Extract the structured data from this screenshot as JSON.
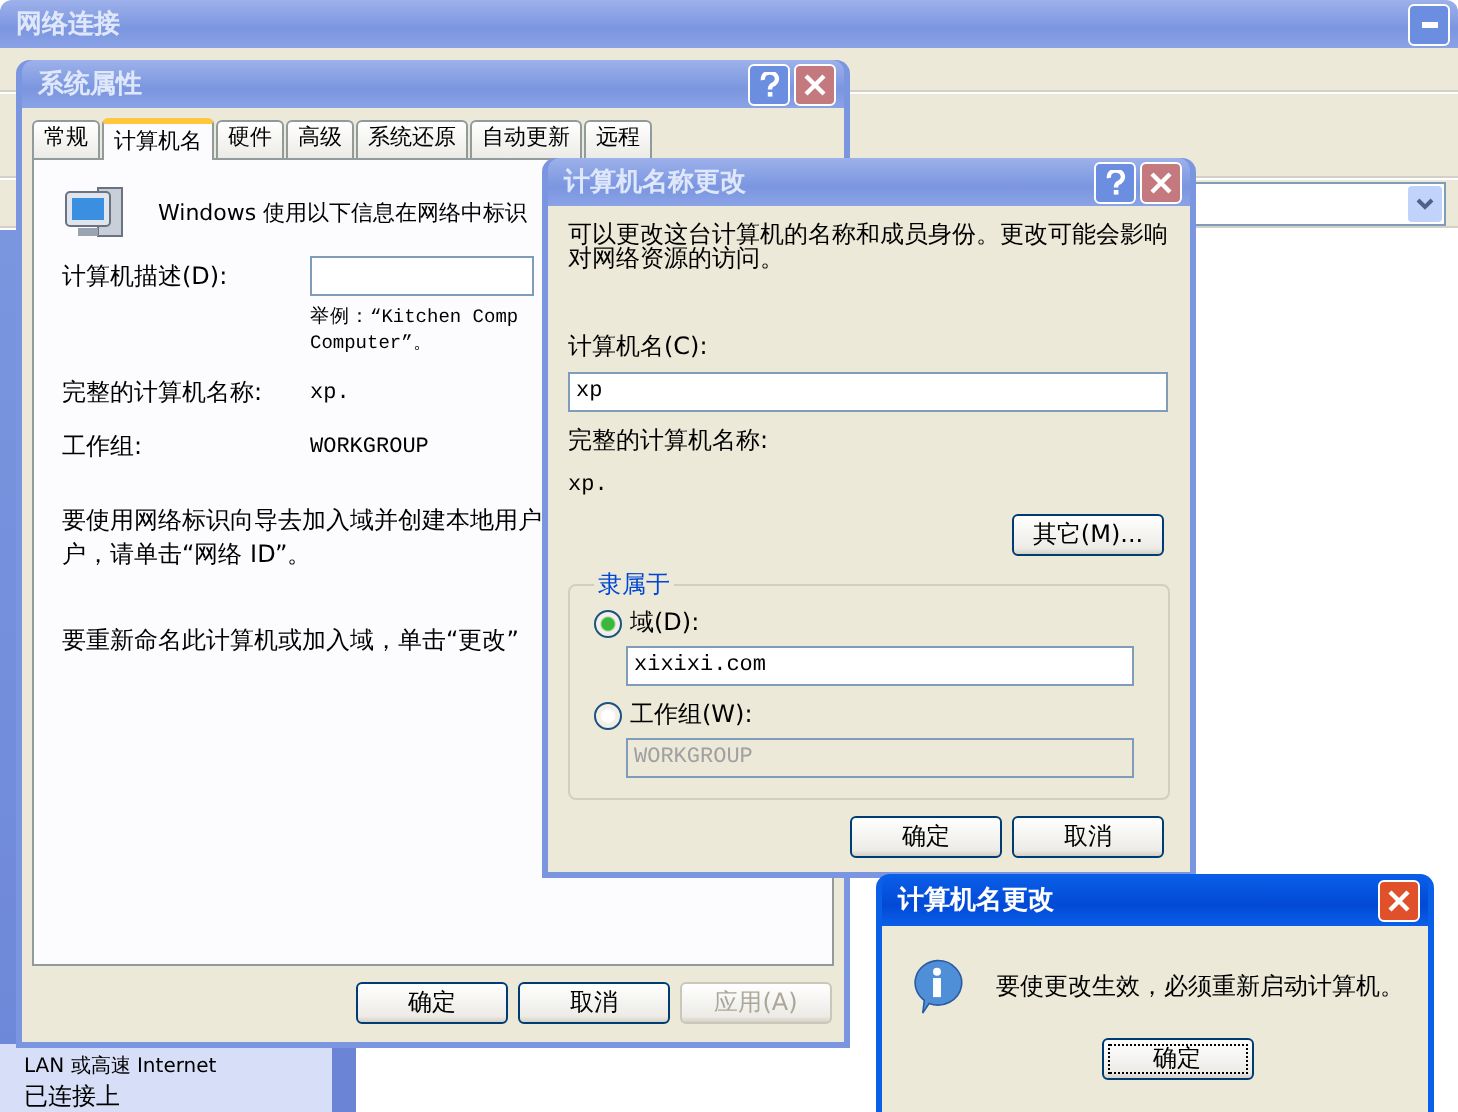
{
  "background_window": {
    "title": "网络连接",
    "details": [
      "LAN 或高速 Internet",
      "已连接上"
    ]
  },
  "system_properties": {
    "title": "系统属性",
    "tabs": [
      {
        "label": "常规",
        "selected": false
      },
      {
        "label": "计算机名",
        "selected": true
      },
      {
        "label": "硬件",
        "selected": false
      },
      {
        "label": "高级",
        "selected": false
      },
      {
        "label": "系统还原",
        "selected": false
      },
      {
        "label": "自动更新",
        "selected": false
      },
      {
        "label": "远程",
        "selected": false
      }
    ],
    "intro": "Windows 使用以下信息在网络中标识",
    "description_label": "计算机描述(D):",
    "example": [
      "举例：“Kitchen Comp",
      "Computer”。"
    ],
    "full_name_label": "完整的计算机名称:",
    "full_name": "xp.",
    "workgroup_label": "工作组:",
    "workgroup": "WORKGROUP",
    "network_id_text": [
      "要使用网络标识向导去加入域并创建本地用户",
      "户，请单击“网络 ID”。"
    ],
    "rename_text": "要重新命名此计算机或加入域，单击“更改”",
    "buttons": [
      {
        "label": "确定",
        "disabled": false
      },
      {
        "label": "取消",
        "disabled": false
      },
      {
        "label": "应用(A)",
        "disabled": true
      }
    ]
  },
  "name_changes": {
    "title": "计算机名称更改",
    "intro": "可以更改这台计算机的名称和成员身份。更改可能会影响对网络资源的访问。",
    "computer_name_label": "计算机名(C):",
    "computer_name": "xp",
    "full_name_label": "完整的计算机名称:",
    "full_name": "xp.",
    "more_button": "其它(M)...",
    "member_of": {
      "legend": "隶属于",
      "options": [
        {
          "label": "域(D):",
          "selected": true,
          "value": "xixixi.com",
          "disabled": false
        },
        {
          "label": "工作组(W):",
          "selected": false,
          "value": "WORKGROUP",
          "disabled": true
        }
      ]
    },
    "buttons": [
      "确定",
      "取消"
    ]
  },
  "message_box": {
    "title": "计算机名更改",
    "message": "要使更改生效，必须重新启动计算机。",
    "button": "确定",
    "focused": true
  }
}
